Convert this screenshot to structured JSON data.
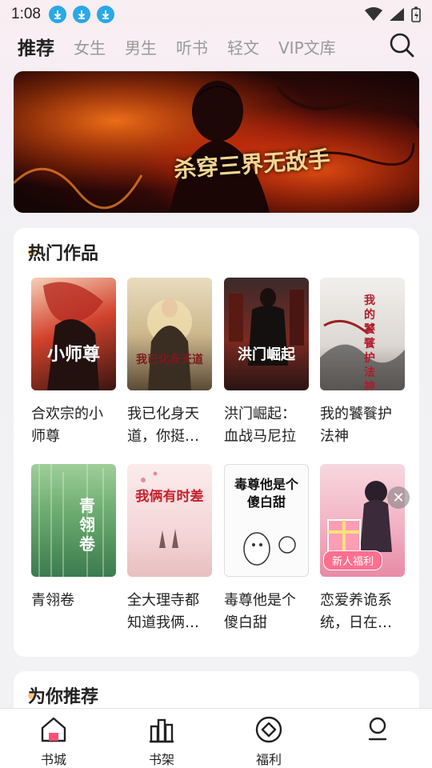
{
  "status": {
    "time": "1:08",
    "download_icons": [
      "download-icon",
      "download-icon",
      "download-icon"
    ],
    "right_icons": [
      "wifi-icon",
      "signal-icon",
      "battery-icon"
    ]
  },
  "nav": {
    "tabs": [
      {
        "label": "推荐",
        "active": true
      },
      {
        "label": "女生"
      },
      {
        "label": "男生"
      },
      {
        "label": "听书"
      },
      {
        "label": "轻文"
      },
      {
        "label": "VIP文库"
      }
    ],
    "search_icon": "search-icon"
  },
  "banner": {
    "title": "杀穿三界无敌手"
  },
  "hot": {
    "title": "热门作品",
    "books": [
      {
        "title": "合欢宗的小师尊",
        "cover_text": "小师尊"
      },
      {
        "title": "我已化身天道，你挺孕肚退婚？",
        "cover_text": "我已化身天道"
      },
      {
        "title": "洪门崛起：血战马尼拉",
        "cover_text": "洪门崛起"
      },
      {
        "title": "我的饕餮护法神",
        "cover_text": "我的饕餮护法神"
      },
      {
        "title": "青翎卷",
        "cover_text": "青翎卷"
      },
      {
        "title": "全大理寺都知道我俩有时差",
        "cover_text": "我俩有时差"
      },
      {
        "title": "毒尊他是个傻白甜",
        "cover_text": "毒尊他是个傻白甜"
      },
      {
        "title": "恋爱养诡系统，日在…",
        "cover_text": "",
        "badge": "新人福利"
      }
    ]
  },
  "recommend": {
    "title": "为你推荐"
  },
  "bottom_nav": [
    {
      "label": "书城",
      "icon": "home-icon",
      "active": true
    },
    {
      "label": "书架",
      "icon": "bookshelf-icon"
    },
    {
      "label": "福利",
      "icon": "welfare-icon"
    },
    {
      "label": "",
      "icon": "profile-icon"
    }
  ],
  "colors": {
    "accent": "#ff4d79",
    "download": "#29a9e6"
  }
}
